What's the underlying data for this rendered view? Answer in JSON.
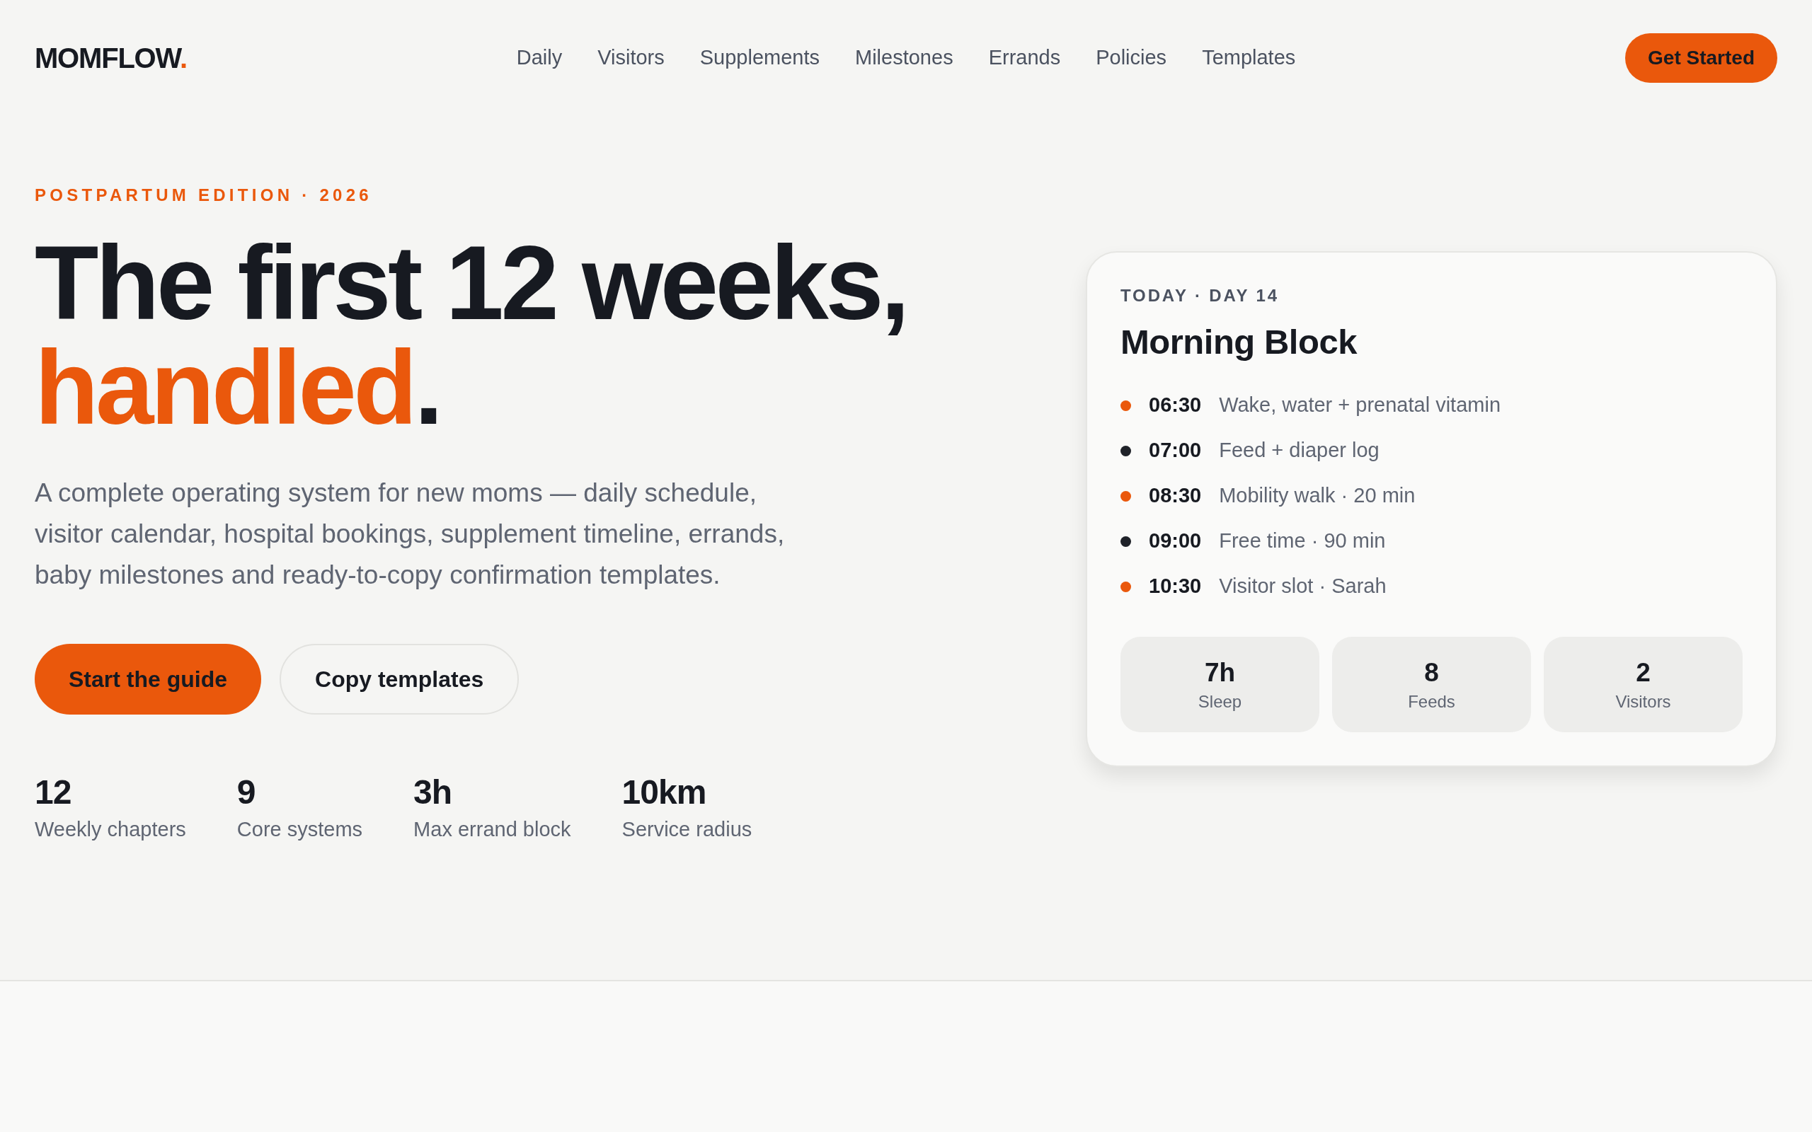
{
  "header": {
    "logo": {
      "text": "MOMFLOW",
      "mark": "."
    },
    "nav": [
      "Daily",
      "Visitors",
      "Supplements",
      "Milestones",
      "Errands",
      "Policies",
      "Templates"
    ],
    "cta": "Get Started"
  },
  "hero": {
    "eyebrow": "POSTPARTUM EDITION · 2026",
    "headline": {
      "text": "The first 12 weeks,",
      "highlight": "handled",
      "end": "."
    },
    "description": "A complete operating system for new moms — daily schedule, visitor calendar, hospital bookings, supplement timeline, errands, baby milestones and ready-to-copy confirmation templates.",
    "buttons": [
      {
        "label": "Start the guide",
        "kind": "primary"
      },
      {
        "label": "Copy templates",
        "kind": "secondary"
      }
    ],
    "stats": [
      {
        "value": "12",
        "label": "Weekly chapters"
      },
      {
        "value": "9",
        "label": "Core systems"
      },
      {
        "value": "3h",
        "label": "Max errand block"
      },
      {
        "value": "10km",
        "label": "Service radius"
      }
    ]
  },
  "today_card": {
    "eyebrow": "TODAY · DAY 14",
    "title": "Morning Block",
    "schedule": [
      {
        "time": "06:30",
        "activity": "Wake, water + prenatal vitamin",
        "color": "#ea580c"
      },
      {
        "time": "07:00",
        "activity": "Feed + diaper log",
        "color": "#1f2229"
      },
      {
        "time": "08:30",
        "activity": "Mobility walk · 20 min",
        "color": "#ea580c"
      },
      {
        "time": "09:00",
        "activity": "Free time · 90 min",
        "color": "#1f2229"
      },
      {
        "time": "10:30",
        "activity": "Visitor slot · Sarah",
        "color": "#ea580c"
      }
    ],
    "summary": [
      {
        "value": "7h",
        "label": "Sleep"
      },
      {
        "value": "8",
        "label": "Feeds"
      },
      {
        "value": "2",
        "label": "Visitors"
      }
    ]
  }
}
